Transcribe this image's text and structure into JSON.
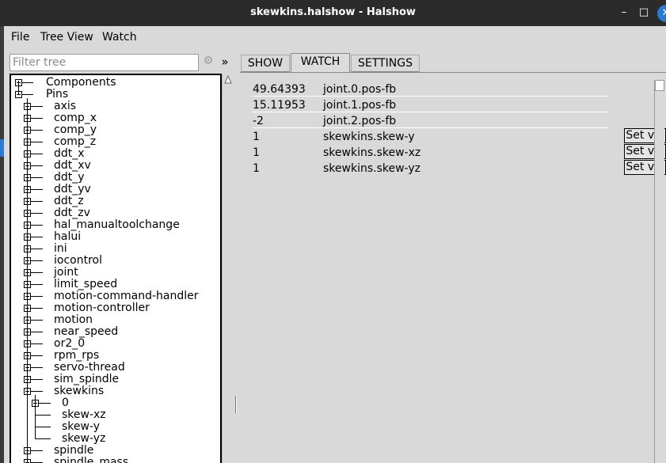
{
  "window": {
    "title": "skewkins.halshow - Halshow",
    "controls": {
      "minimize": "–",
      "maximize": "□",
      "close": "✕"
    }
  },
  "menu": {
    "items": [
      "File",
      "Tree View",
      "Watch"
    ]
  },
  "filter": {
    "placeholder": "Filter tree",
    "value": ""
  },
  "toolbar": {
    "gear_icon": "gear-icon",
    "more_label": "»"
  },
  "tree": {
    "roots": [
      {
        "label": "Components",
        "expanded": false
      },
      {
        "label": "Pins",
        "expanded": true
      }
    ],
    "pins": [
      "axis",
      "comp_x",
      "comp_y",
      "comp_z",
      "ddt_x",
      "ddt_xv",
      "ddt_y",
      "ddt_yv",
      "ddt_z",
      "ddt_zv",
      "hal_manualtoolchange",
      "halui",
      "ini",
      "iocontrol",
      "joint",
      "limit_speed",
      "motion-command-handler",
      "motion-controller",
      "motion",
      "near_speed",
      "or2_0",
      "rpm_rps",
      "servo-thread",
      "sim_spindle",
      "skewkins",
      "spindle",
      "spindle_mass"
    ],
    "skewkins_children": [
      {
        "label": "0",
        "expandable": true
      },
      {
        "label": "skew-xz",
        "expandable": false
      },
      {
        "label": "skew-y",
        "expandable": false
      },
      {
        "label": "skew-yz",
        "expandable": false
      }
    ]
  },
  "tabs": [
    {
      "label": "SHOW",
      "active": false
    },
    {
      "label": "WATCH",
      "active": true
    },
    {
      "label": "SETTINGS",
      "active": false
    }
  ],
  "watch": {
    "set_label": "Set val",
    "rows": [
      {
        "value": "49.64393",
        "name": "joint.0.pos-fb",
        "settable": false
      },
      {
        "value": "15.11953",
        "name": "joint.1.pos-fb",
        "settable": false
      },
      {
        "value": "-2",
        "name": "joint.2.pos-fb",
        "settable": false
      },
      {
        "value": "1",
        "name": "skewkins.skew-y",
        "settable": true
      },
      {
        "value": "1",
        "name": "skewkins.skew-xz",
        "settable": true
      },
      {
        "value": "1",
        "name": "skewkins.skew-yz",
        "settable": true
      }
    ]
  },
  "colors": {
    "titlebar": "#2b2b2b",
    "accent": "#2a7bd4",
    "panel": "#d9d9d9"
  }
}
